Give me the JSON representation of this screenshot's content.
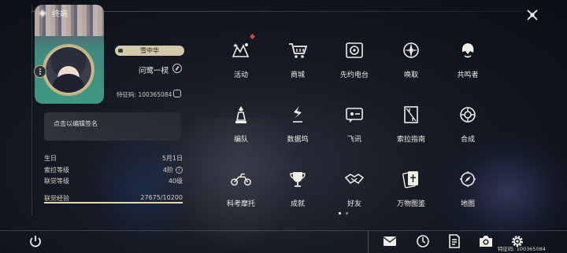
{
  "header": {
    "name": "终端"
  },
  "profile": {
    "badge": "雪中华",
    "nickname": "问鹭一棂",
    "uid_label": "特征码:",
    "uid": "100365084",
    "signature_placeholder": "点击以编辑签名"
  },
  "stats": [
    {
      "key": "生日",
      "value": "5月1日"
    },
    {
      "key": "索拉等级",
      "value": "4阶"
    },
    {
      "key": "联觉等级",
      "value": "40级"
    }
  ],
  "experience": {
    "label": "联觉经验",
    "current": 27675,
    "max": 10200,
    "text": "27675/10200",
    "fill_fraction": 1.0
  },
  "menu": [
    {
      "id": "activity",
      "label": "活动",
      "icon": "activity-icon",
      "alert": true
    },
    {
      "id": "shop",
      "label": "商城",
      "icon": "shopping-cart-icon"
    },
    {
      "id": "radio",
      "label": "先约电台",
      "icon": "radio-icon"
    },
    {
      "id": "summon",
      "label": "唤取",
      "icon": "summon-compass-icon"
    },
    {
      "id": "resonators",
      "label": "共鸣者",
      "icon": "character-icon"
    },
    {
      "id": "team",
      "label": "编队",
      "icon": "team-chess-icon"
    },
    {
      "id": "data-dock",
      "label": "数据坞",
      "icon": "data-dock-icon"
    },
    {
      "id": "messages",
      "label": "飞讯",
      "icon": "messenger-icon"
    },
    {
      "id": "guide",
      "label": "索拉指南",
      "icon": "guide-book-icon"
    },
    {
      "id": "synthesis",
      "label": "合成",
      "icon": "synthesis-icon"
    },
    {
      "id": "commission",
      "label": "科考摩托",
      "icon": "motorcycle-icon"
    },
    {
      "id": "achievements",
      "label": "成就",
      "icon": "trophy-icon"
    },
    {
      "id": "friends",
      "label": "好友",
      "icon": "handshake-icon"
    },
    {
      "id": "collection",
      "label": "万物图鉴",
      "icon": "card-collection-icon"
    },
    {
      "id": "map",
      "label": "地图",
      "icon": "map-compass-icon"
    }
  ],
  "pagination": {
    "pages": 2,
    "active": 1
  },
  "bottom": {
    "uid_text": "特征码: 100365084",
    "icons": [
      "power-icon",
      "mail-icon",
      "clock-icon",
      "notice-icon",
      "camera-icon",
      "settings-gear-icon"
    ]
  },
  "colors": {
    "accent": "#d4c9a8",
    "alert": "#d4453a",
    "text": "#f0ede4"
  }
}
